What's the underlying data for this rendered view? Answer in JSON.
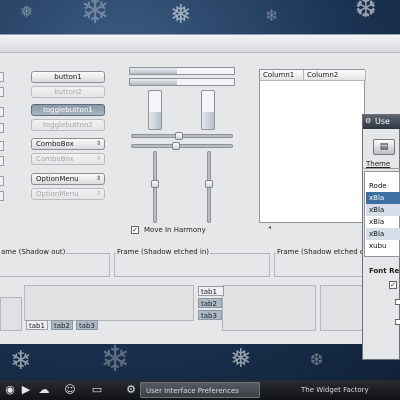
{
  "desktop": {
    "wallpaper": "snowflake-blue"
  },
  "buttons": {
    "button1": "button1",
    "button2": "button2",
    "togglebutton1": "togglebutton1",
    "togglebutton2": "togglebutton2",
    "combobox1": "ComboBox",
    "combobox2": "ComboBox",
    "optionmenu1": "OptionMenu",
    "optionmenu2": "OptionMenu"
  },
  "controls": {
    "move_in_harmony_label": "Move In Harmony",
    "move_in_harmony_checked": true,
    "hslider1_value": 0.47,
    "hslider2_value": 0.43,
    "vslider1_value": 0.45,
    "vslider2_value": 0.45,
    "hprogress1_value": 0.45,
    "hprogress2_value": 0.45,
    "vprogress1_value": 0.45,
    "vprogress2_value": 0.45
  },
  "treeview": {
    "columns": [
      "Column1",
      "Column2"
    ]
  },
  "frames": {
    "shadow_out": "ame (Shadow out)",
    "shadow_etched_in": "Frame (Shadow etched in)",
    "shadow_etched_out": "Frame (Shadow etched out)"
  },
  "tabs_bottom": [
    "tab1",
    "tab2",
    "tab3"
  ],
  "tabs_left": [
    "tab1",
    "tab2",
    "tab3"
  ],
  "prefs": {
    "title": "Use",
    "theme_header": "Theme",
    "themes": [
      "Rode",
      "xBla",
      "xBla",
      "xBla",
      "xBla",
      "xubu"
    ],
    "selected_index": 1,
    "font_label": "Font Re"
  },
  "taskbar": {
    "tasks": [
      "User Interface Preferences",
      "The Widget Factory"
    ],
    "active_task_index": 0
  }
}
